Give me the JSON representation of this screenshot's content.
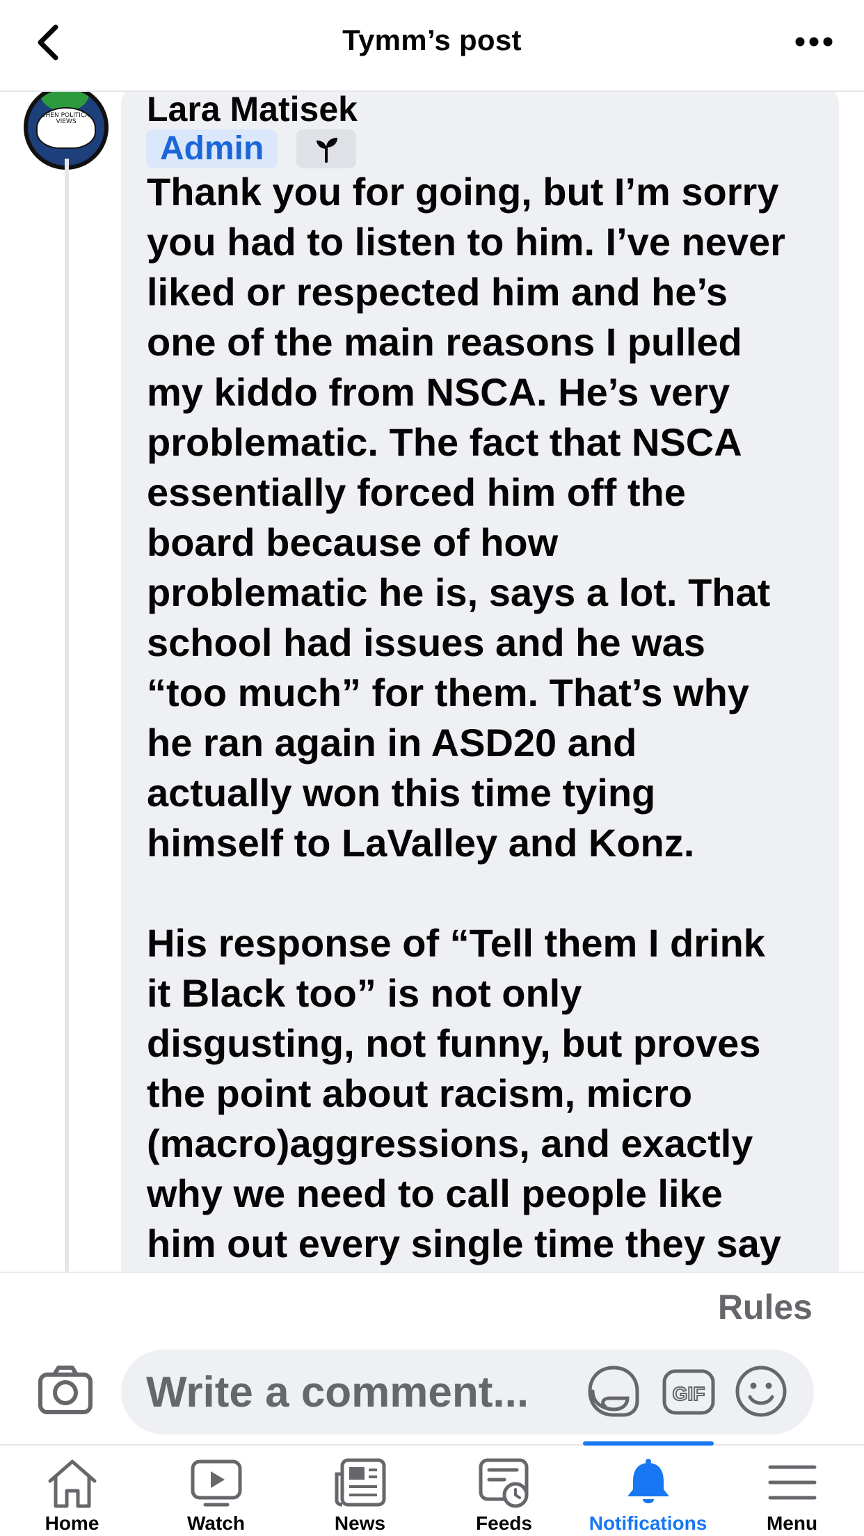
{
  "header": {
    "title": "Tymm’s post",
    "back_icon": "chevron-left-icon",
    "more_icon": "more-horizontal-icon"
  },
  "comment": {
    "author": "Lara Matisek",
    "badge_admin": "Admin",
    "badge_icon": "sprout-icon",
    "avatar_text": "WHEN POLITICAL VIEWS",
    "text": "Thank you for going, but I’m sorry\nyou had to listen to him. I’ve never\nliked or respected him and he’s\none of the main reasons I pulled\nmy kiddo from NSCA. He’s very\nproblematic. The fact that NSCA\nessentially forced him off the\nboard because of how\nproblematic he is, says a lot. That\nschool had issues and he was\n“too much” for them. That’s why\nhe ran again in ASD20 and\nactually won this time tying\nhimself to LaValley and Konz.\n\nHis response of “Tell them I drink\nit Black too” is not only\ndisgusting, not funny, but proves\nthe point about racism, micro\n(macro)aggressions, and exactly\nwhy we need to call people like\nhim out every single time they say"
  },
  "composer": {
    "rules_label": "Rules",
    "placeholder": "Write a comment...",
    "camera_icon": "camera-icon",
    "sticker_icon": "sticker-icon",
    "gif_label": "GIF",
    "emoji_icon": "emoji-icon"
  },
  "tabbar": {
    "active_tab": "Notifications",
    "accent_color": "#1877f2",
    "items": [
      {
        "label": "Home",
        "icon": "home-icon"
      },
      {
        "label": "Watch",
        "icon": "watch-icon"
      },
      {
        "label": "News",
        "icon": "news-icon"
      },
      {
        "label": "Feeds",
        "icon": "feeds-icon"
      },
      {
        "label": "Notifications",
        "icon": "bell-icon"
      },
      {
        "label": "Menu",
        "icon": "menu-icon"
      }
    ]
  }
}
